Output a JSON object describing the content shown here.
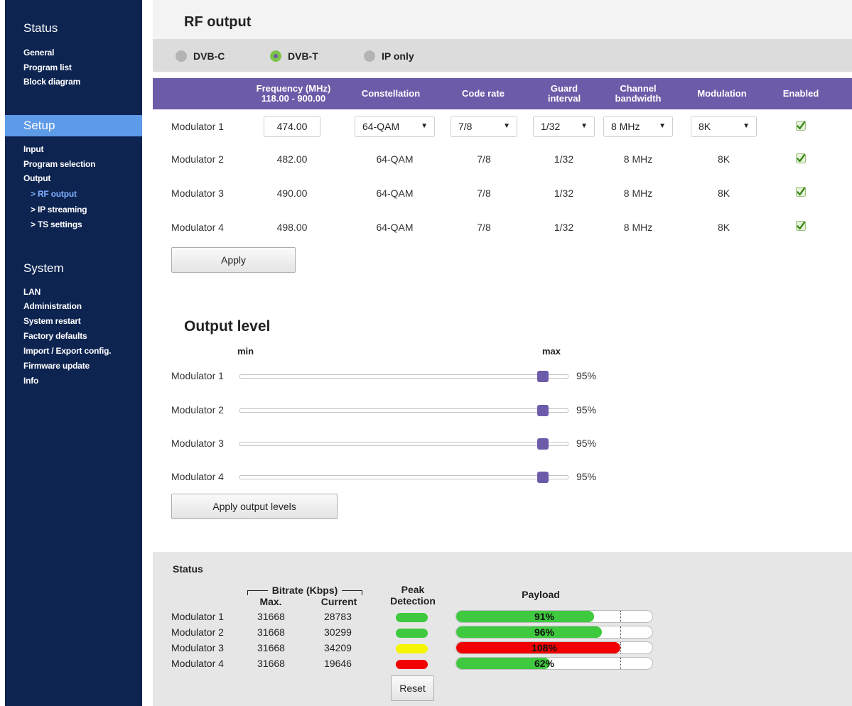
{
  "sidebar": {
    "status_title": "Status",
    "status_items": [
      "General",
      "Program list",
      "Block diagram"
    ],
    "setup_title": "Setup",
    "setup_items": [
      "Input",
      "Program selection",
      "Output"
    ],
    "output_items": [
      "> RF output",
      "> IP streaming",
      "> TS settings"
    ],
    "system_title": "System",
    "system_items": [
      "LAN",
      "Administration",
      "System restart",
      "Factory defaults",
      "Import / Export config.",
      "Firmware update",
      "Info"
    ]
  },
  "rf": {
    "title": "RF output",
    "modes": [
      {
        "label": "DVB-C",
        "selected": false
      },
      {
        "label": "DVB-T",
        "selected": true
      },
      {
        "label": "IP only",
        "selected": false
      }
    ],
    "headers": {
      "frequency": "Frequency (MHz)",
      "frequency_range": "118.00 - 900.00",
      "constellation": "Constellation",
      "code_rate": "Code rate",
      "guard_1": "Guard",
      "guard_2": "interval",
      "bw_1": "Channel",
      "bw_2": "bandwidth",
      "modulation": "Modulation",
      "enabled": "Enabled"
    },
    "rows": [
      {
        "name": "Modulator 1",
        "frequency": "474.00",
        "constellation": "64-QAM",
        "code_rate": "7/8",
        "guard": "1/32",
        "bandwidth": "8 MHz",
        "modulation": "8K",
        "enabled": true
      },
      {
        "name": "Modulator 2",
        "frequency": "482.00",
        "constellation": "64-QAM",
        "code_rate": "7/8",
        "guard": "1/32",
        "bandwidth": "8 MHz",
        "modulation": "8K",
        "enabled": true
      },
      {
        "name": "Modulator 3",
        "frequency": "490.00",
        "constellation": "64-QAM",
        "code_rate": "7/8",
        "guard": "1/32",
        "bandwidth": "8 MHz",
        "modulation": "8K",
        "enabled": true
      },
      {
        "name": "Modulator 4",
        "frequency": "498.00",
        "constellation": "64-QAM",
        "code_rate": "7/8",
        "guard": "1/32",
        "bandwidth": "8 MHz",
        "modulation": "8K",
        "enabled": true
      }
    ],
    "apply_label": "Apply"
  },
  "output_level": {
    "title": "Output level",
    "min_label": "min",
    "max_label": "max",
    "rows": [
      {
        "name": "Modulator 1",
        "level": 95,
        "label": "95%"
      },
      {
        "name": "Modulator 2",
        "level": 95,
        "label": "95%"
      },
      {
        "name": "Modulator 3",
        "level": 95,
        "label": "95%"
      },
      {
        "name": "Modulator 4",
        "level": 95,
        "label": "95%"
      }
    ],
    "apply_label": "Apply output levels"
  },
  "status": {
    "title": "Status",
    "bitrate_header": "Bitrate (Kbps)",
    "max_header": "Max.",
    "current_header": "Current",
    "peak_header_1": "Peak",
    "peak_header_2": "Detection",
    "payload_header": "Payload",
    "rows": [
      {
        "name": "Modulator 1",
        "max": "31668",
        "current": "28783",
        "peak_color": "#3ec93e",
        "payload": 91,
        "payload_label": "91%",
        "payload_color": "#3ec93e"
      },
      {
        "name": "Modulator 2",
        "max": "31668",
        "current": "30299",
        "peak_color": "#3ec93e",
        "payload": 96,
        "payload_label": "96%",
        "payload_color": "#3ec93e"
      },
      {
        "name": "Modulator 3",
        "max": "31668",
        "current": "34209",
        "peak_color": "#f5f500",
        "payload": 108,
        "payload_label": "108%",
        "payload_color": "#f20000"
      },
      {
        "name": "Modulator 4",
        "max": "31668",
        "current": "19646",
        "peak_color": "#f20000",
        "payload": 62,
        "payload_label": "62%",
        "payload_color": "#3ec93e"
      }
    ],
    "reset_label": "Reset"
  },
  "colors": {
    "sidebar_bg": "#0d2451",
    "active_section": "#5d9be8",
    "table_header": "#6c5ba8",
    "slider_thumb": "#6b5ba9",
    "enabled_check": "#5cb82e"
  }
}
